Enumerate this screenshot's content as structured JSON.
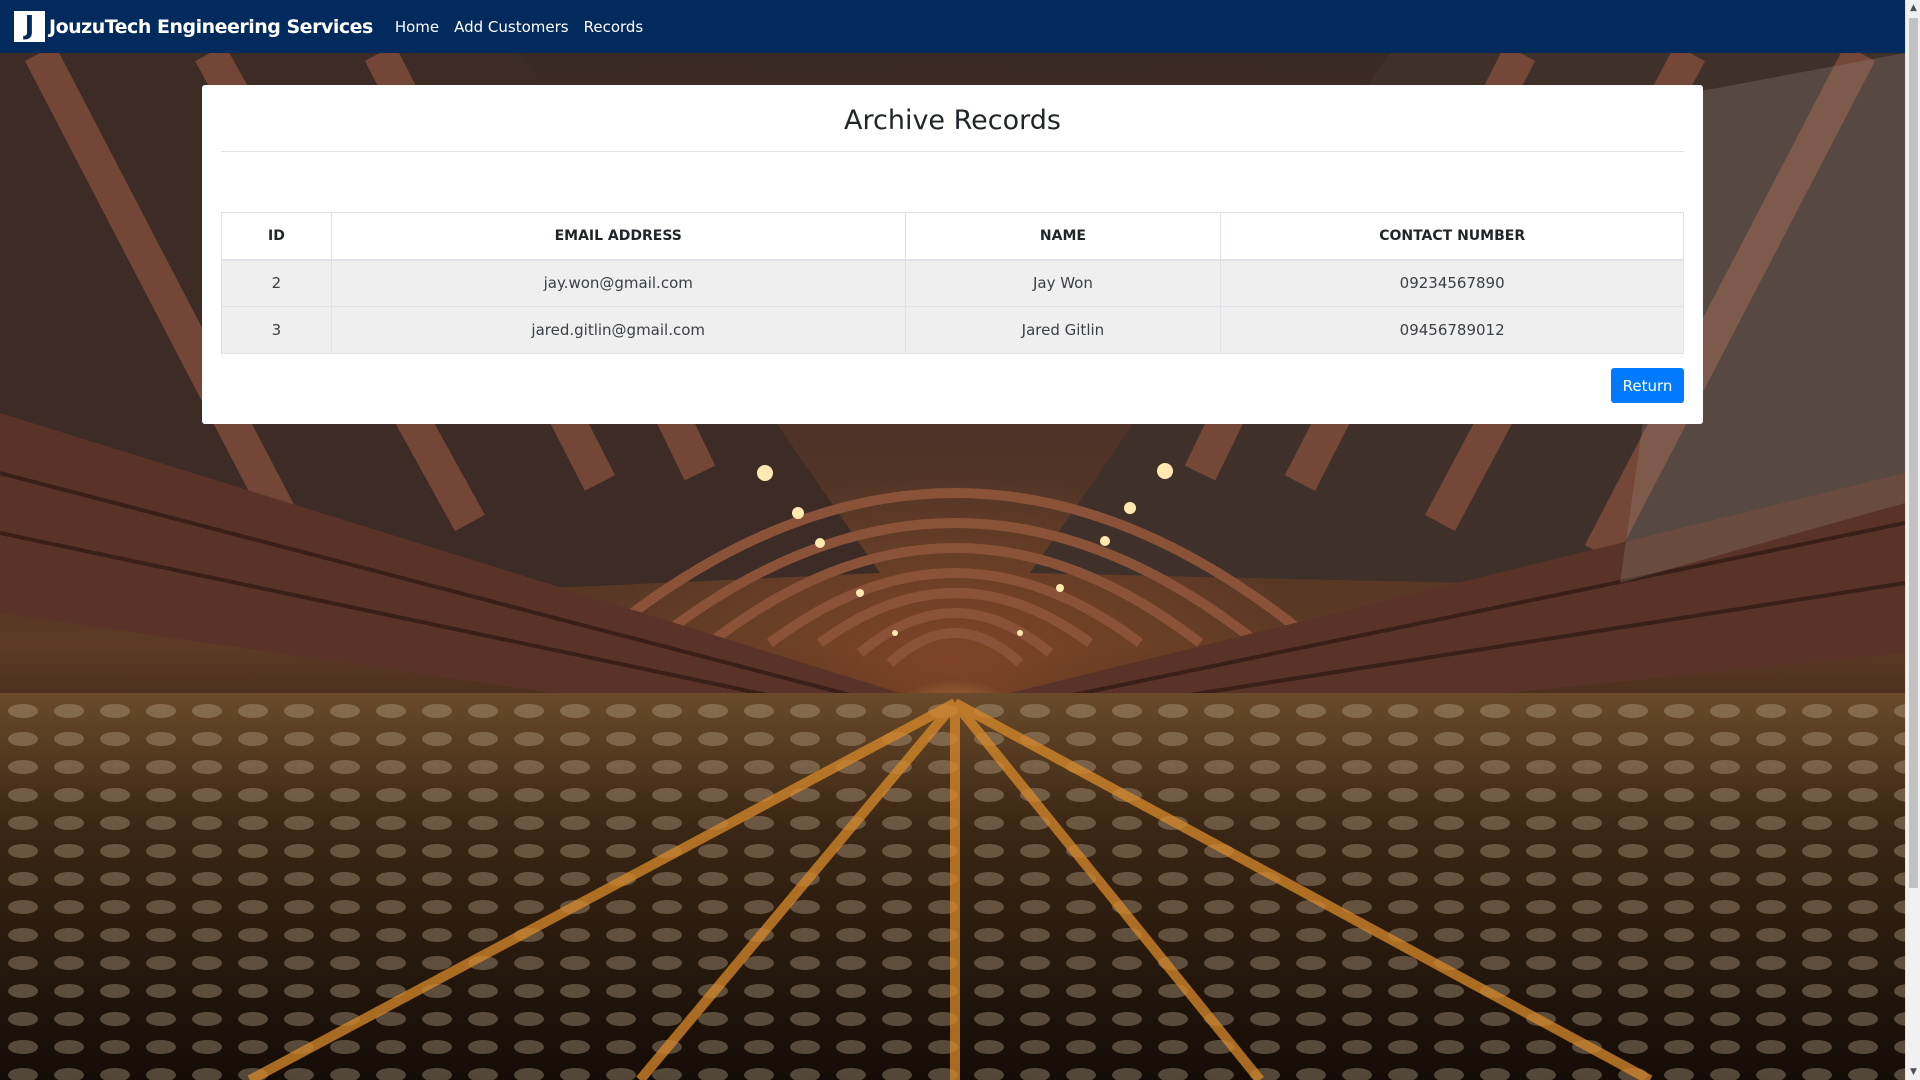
{
  "navbar": {
    "logo_letter": "J",
    "brand": "JouzuTech Engineering Services",
    "links": [
      "Home",
      "Add Customers",
      "Records"
    ]
  },
  "card": {
    "title": "Archive Records",
    "table": {
      "headers": [
        "ID",
        "EMAIL ADDRESS",
        "NAME",
        "CONTACT NUMBER"
      ],
      "rows": [
        [
          "2",
          "jay.won@gmail.com",
          "Jay Won",
          "09234567890"
        ],
        [
          "3",
          "jared.gitlin@gmail.com",
          "Jared Gitlin",
          "09456789012"
        ]
      ]
    },
    "return_label": "Return"
  },
  "colors": {
    "navbar": "#032a5c",
    "primary_button": "#007bff"
  }
}
